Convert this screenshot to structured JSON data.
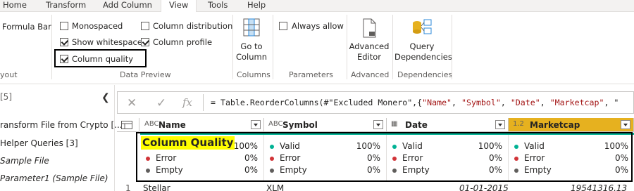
{
  "menu": {
    "tabs": [
      "Home",
      "Transform",
      "Add Column",
      "View",
      "Tools",
      "Help"
    ],
    "active": "View"
  },
  "ribbon": {
    "formula_bar": "Formula Bar",
    "layout_label": "yout",
    "monospaced": "Monospaced",
    "show_whitespace": "Show whitespace",
    "column_quality": "Column quality",
    "column_distribution": "Column distribution",
    "column_profile": "Column profile",
    "data_preview_label": "Data Preview",
    "go_to_column_line1": "Go to",
    "go_to_column_line2": "Column",
    "columns_label": "Columns",
    "always_allow": "Always allow",
    "parameters_label": "Parameters",
    "advanced_editor_line1": "Advanced",
    "advanced_editor_line2": "Editor",
    "advanced_label": "Advanced",
    "query_dependencies_line1": "Query",
    "query_dependencies_line2": "Dependencies",
    "dependencies_label": "Dependencies"
  },
  "nav": {
    "count": "[5]",
    "items": [
      "ransform File from Crypto [...",
      "Helper Queries [3]",
      "Sample File",
      "Parameter1 (Sample File)"
    ]
  },
  "formula": {
    "prefix": "= Table.ReorderColumns(#\"Excluded Monero\",{",
    "s1": "\"Name\"",
    "s2": "\"Symbol\"",
    "s3": "\"Date\"",
    "s4": "\"Marketcap\"",
    "tail": ", \"",
    "fx": "fx"
  },
  "grid": {
    "columns": [
      {
        "type": "ABC",
        "name": "Name"
      },
      {
        "type": "ABC",
        "name": "Symbol"
      },
      {
        "type": "▦",
        "name": "Date"
      },
      {
        "type": "1.2",
        "name": "Marketcap"
      }
    ],
    "quality_title": "Column Quality",
    "quality": [
      {
        "valid": "Valid",
        "valid_pct": "100%",
        "error": "Error",
        "error_pct": "0%",
        "empty": "Empty",
        "empty_pct": "0%"
      },
      {
        "valid": "Valid",
        "valid_pct": "100%",
        "error": "Error",
        "error_pct": "0%",
        "empty": "Empty",
        "empty_pct": "0%"
      },
      {
        "valid": "Valid",
        "valid_pct": "100%",
        "error": "Error",
        "error_pct": "0%",
        "empty": "Empty",
        "empty_pct": "0%"
      },
      {
        "valid": "Valid",
        "valid_pct": "100%",
        "error": "Error",
        "error_pct": "0%",
        "empty": "Empty",
        "empty_pct": "0%"
      }
    ],
    "row1": {
      "index": "1",
      "name": "Stellar",
      "symbol": "XLM",
      "date": "01-01-2015",
      "marketcap": "19541316.13"
    }
  },
  "colors": {
    "valid": "#00b294",
    "error": "#d13438",
    "empty": "#605e5c",
    "selected_header": "#e6b11f",
    "highlight": "#ffff00"
  }
}
